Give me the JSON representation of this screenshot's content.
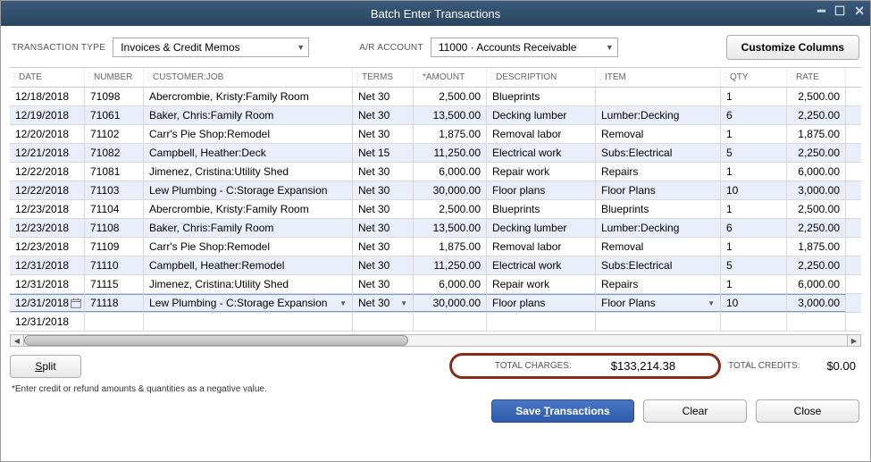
{
  "window": {
    "title": "Batch Enter Transactions"
  },
  "toolbar": {
    "type_label": "TRANSACTION TYPE",
    "type_value": "Invoices & Credit Memos",
    "ar_label": "A/R ACCOUNT",
    "ar_value": "11000 · Accounts Receivable",
    "customize": "Customize Columns"
  },
  "columns": {
    "date": "DATE",
    "number": "NUMBER",
    "customer": "CUSTOMER:JOB",
    "terms": "TERMS",
    "amount": "*AMOUNT",
    "desc": "DESCRIPTION",
    "item": "ITEM",
    "qty": "QTY",
    "rate": "RATE"
  },
  "rows": [
    {
      "date": "12/18/2018",
      "number": "71098",
      "customer": "Abercrombie, Kristy:Family Room",
      "terms": "Net 30",
      "amount": "2,500.00",
      "desc": "Blueprints",
      "item": "",
      "qty": "1",
      "rate": "2,500.00"
    },
    {
      "date": "12/19/2018",
      "number": "71061",
      "customer": "Baker, Chris:Family Room",
      "terms": "Net 30",
      "amount": "13,500.00",
      "desc": "Decking lumber",
      "item": "Lumber:Decking",
      "qty": "6",
      "rate": "2,250.00"
    },
    {
      "date": "12/20/2018",
      "number": "71102",
      "customer": "Carr's Pie Shop:Remodel",
      "terms": "Net 30",
      "amount": "1,875.00",
      "desc": "Removal labor",
      "item": "Removal",
      "qty": "1",
      "rate": "1,875.00"
    },
    {
      "date": "12/21/2018",
      "number": "71082",
      "customer": "Campbell, Heather:Deck",
      "terms": "Net 15",
      "amount": "11,250.00",
      "desc": "Electrical work",
      "item": "Subs:Electrical",
      "qty": "5",
      "rate": "2,250.00"
    },
    {
      "date": "12/22/2018",
      "number": "71081",
      "customer": "Jimenez, Cristina:Utility Shed",
      "terms": "Net 30",
      "amount": "6,000.00",
      "desc": "Repair work",
      "item": "Repairs",
      "qty": "1",
      "rate": "6,000.00"
    },
    {
      "date": "12/22/2018",
      "number": "71103",
      "customer": "Lew Plumbing - C:Storage Expansion",
      "terms": "Net 30",
      "amount": "30,000.00",
      "desc": "Floor plans",
      "item": "Floor Plans",
      "qty": "10",
      "rate": "3,000.00"
    },
    {
      "date": "12/23/2018",
      "number": "71104",
      "customer": "Abercrombie, Kristy:Family Room",
      "terms": "Net 30",
      "amount": "2,500.00",
      "desc": "Blueprints",
      "item": "Blueprints",
      "qty": "1",
      "rate": "2,500.00"
    },
    {
      "date": "12/23/2018",
      "number": "71108",
      "customer": "Baker, Chris:Family Room",
      "terms": "Net 30",
      "amount": "13,500.00",
      "desc": "Decking lumber",
      "item": "Lumber:Decking",
      "qty": "6",
      "rate": "2,250.00"
    },
    {
      "date": "12/23/2018",
      "number": "71109",
      "customer": "Carr's Pie Shop:Remodel",
      "terms": "Net 30",
      "amount": "1,875.00",
      "desc": "Removal labor",
      "item": "Removal",
      "qty": "1",
      "rate": "1,875.00"
    },
    {
      "date": "12/31/2018",
      "number": "71110",
      "customer": "Campbell, Heather:Remodel",
      "terms": "Net 30",
      "amount": "11,250.00",
      "desc": "Electrical work",
      "item": "Subs:Electrical",
      "qty": "5",
      "rate": "2,250.00"
    },
    {
      "date": "12/31/2018",
      "number": "71115",
      "customer": "Jimenez, Cristina:Utility Shed",
      "terms": "Net 30",
      "amount": "6,000.00",
      "desc": "Repair work",
      "item": "Repairs",
      "qty": "1",
      "rate": "6,000.00"
    },
    {
      "date": "12/31/2018",
      "number": "71118",
      "customer": "Lew Plumbing - C:Storage Expansion",
      "terms": "Net 30",
      "amount": "30,000.00",
      "desc": "Floor plans",
      "item": "Floor Plans",
      "qty": "10",
      "rate": "3,000.00",
      "active": true
    },
    {
      "date": "12/31/2018",
      "number": "",
      "customer": "",
      "terms": "",
      "amount": "",
      "desc": "",
      "item": "",
      "qty": "",
      "rate": ""
    }
  ],
  "split_label": "Split",
  "totals": {
    "charges_label": "TOTAL CHARGES:",
    "charges_value": "$133,214.38",
    "credits_label": "TOTAL CREDITS:",
    "credits_value": "$0.00"
  },
  "footnote": "*Enter credit or refund amounts & quantities as a negative value.",
  "buttons": {
    "save": "Save Transactions",
    "clear": "Clear",
    "close": "Close"
  }
}
